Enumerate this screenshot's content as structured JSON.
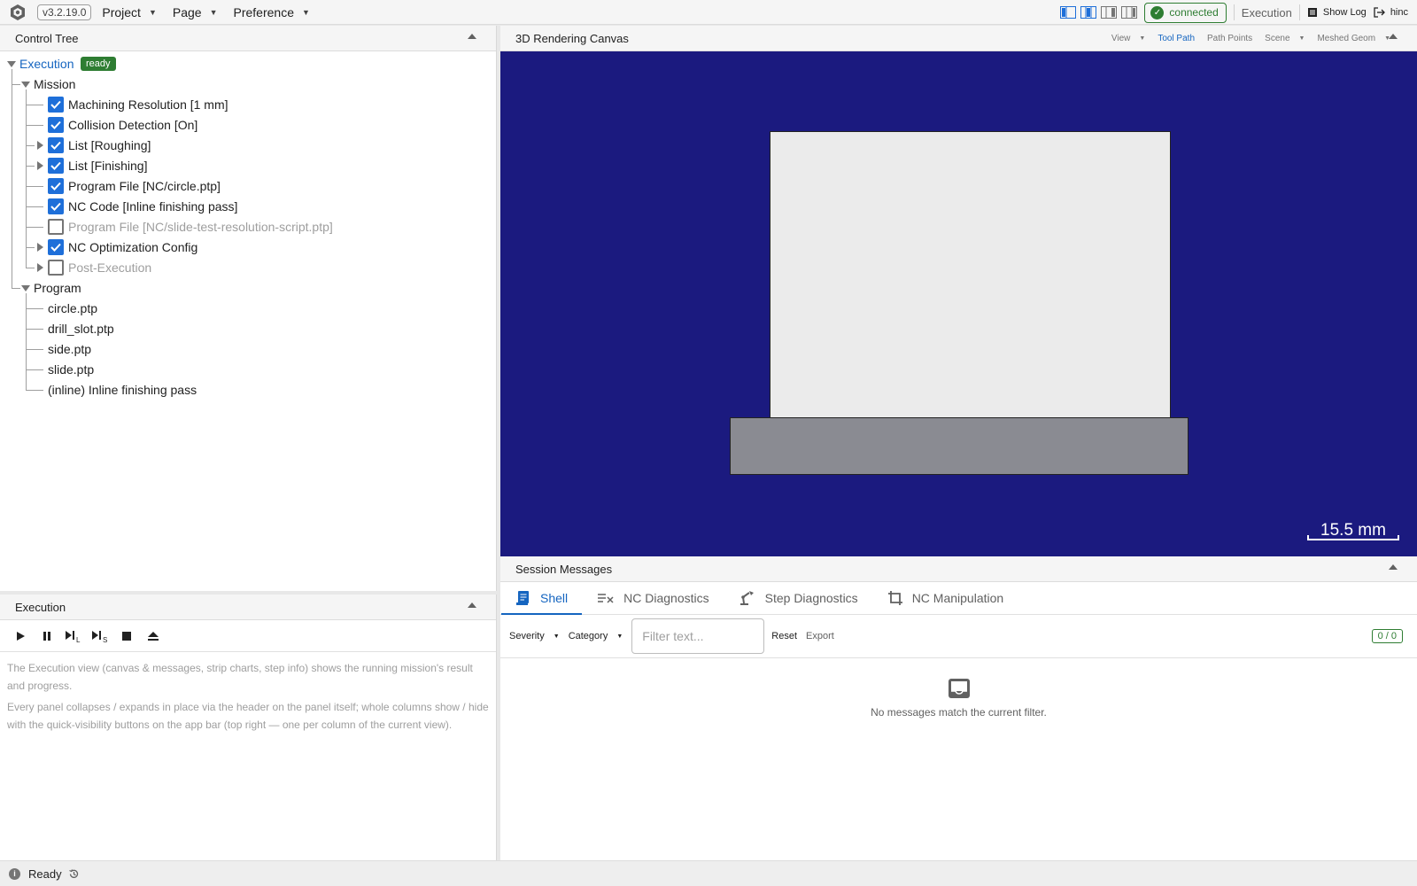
{
  "appbar": {
    "version": "v3.2.19.0",
    "menus": [
      "Project",
      "Page",
      "Preference"
    ],
    "connection_status": "connected",
    "view_name": "Execution",
    "show_log": "Show Log",
    "user": "hinc",
    "status_color": "#2e7d32",
    "accent_color": "#1e6fd9"
  },
  "control_tree": {
    "title": "Control Tree",
    "root_label": "Execution",
    "root_status": "ready",
    "mission_label": "Mission",
    "mission_items": [
      {
        "label": "Machining Resolution [1 mm]",
        "checked": true,
        "expandable": false
      },
      {
        "label": "Collision Detection [On]",
        "checked": true,
        "expandable": false
      },
      {
        "label": "List [Roughing]",
        "checked": true,
        "expandable": true
      },
      {
        "label": "List [Finishing]",
        "checked": true,
        "expandable": true
      },
      {
        "label": "Program File [NC/circle.ptp]",
        "checked": true,
        "expandable": false
      },
      {
        "label": "NC Code [Inline finishing pass]",
        "checked": true,
        "expandable": false
      },
      {
        "label": "Program File [NC/slide-test-resolution-script.ptp]",
        "checked": false,
        "expandable": false
      },
      {
        "label": "NC Optimization Config",
        "checked": true,
        "expandable": true
      },
      {
        "label": "Post-Execution",
        "checked": false,
        "expandable": true
      }
    ],
    "program_label": "Program",
    "program_items": [
      "circle.ptp",
      "drill_slot.ptp",
      "side.ptp",
      "slide.ptp",
      "(inline) Inline finishing pass"
    ]
  },
  "execution": {
    "title": "Execution",
    "paragraph1": "The Execution view (canvas & messages, strip charts, step info) shows the running mission's result and progress.",
    "paragraph2": "Every panel collapses / expands in place via the header on the panel itself; whole columns show / hide with the quick-visibility buttons on the app bar (top right — one per column of the current view)."
  },
  "canvas": {
    "title": "3D Rendering Canvas",
    "tools": [
      "View",
      "Tool Path",
      "Path Points",
      "Scene",
      "Meshed Geom"
    ],
    "active_tool": "Tool Path",
    "scale_label": "15.5 mm",
    "background_color": "#1b1a7f"
  },
  "messages": {
    "title": "Session Messages",
    "tabs": [
      "Shell",
      "NC Diagnostics",
      "Step Diagnostics",
      "NC Manipulation"
    ],
    "active_tab": "Shell",
    "severity_label": "Severity",
    "category_label": "Category",
    "filter_placeholder": "Filter text...",
    "reset_label": "Reset",
    "export_label": "Export",
    "count": "0 / 0",
    "empty_text": "No messages match the current filter."
  },
  "statusbar": {
    "status": "Ready"
  }
}
